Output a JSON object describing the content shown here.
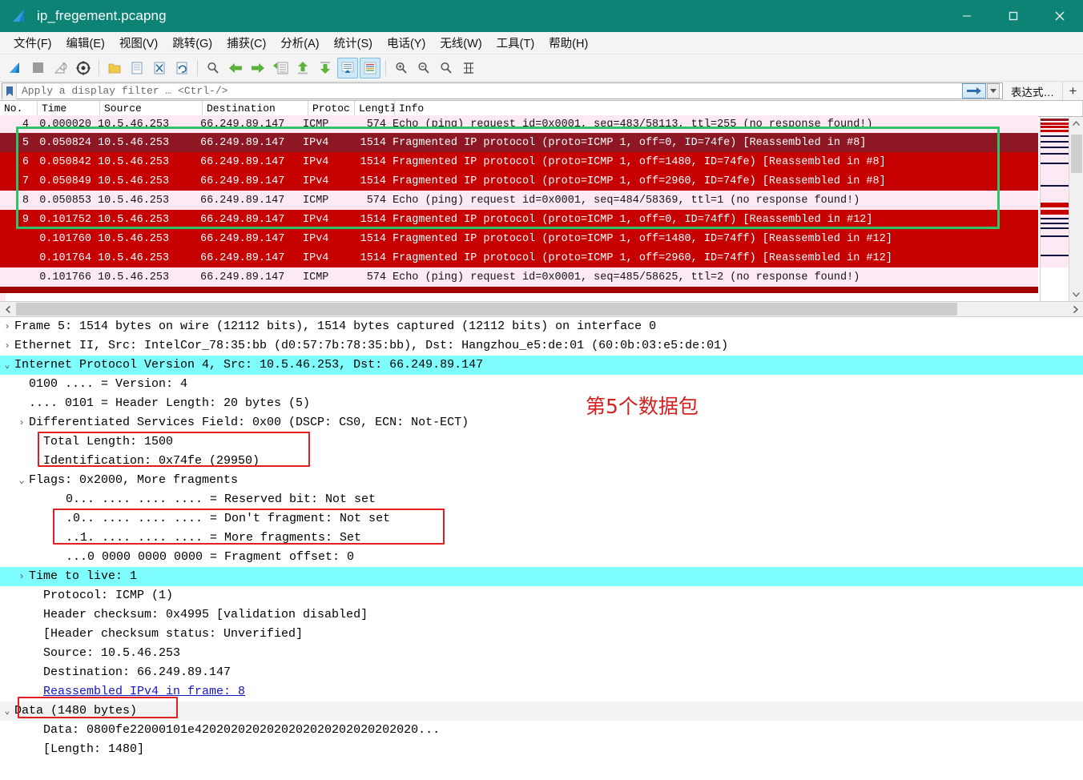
{
  "window": {
    "title": "ip_fregement.pcapng",
    "app_icon": "wireshark-fin-icon",
    "minimize_label": "—",
    "maximize_label": "☐",
    "close_label": "✕",
    "titlebar_color": "#0c8374"
  },
  "menu": {
    "items": [
      {
        "label": "文件(F)",
        "mnemonic": "F"
      },
      {
        "label": "编辑(E)",
        "mnemonic": "E"
      },
      {
        "label": "视图(V)",
        "mnemonic": "V"
      },
      {
        "label": "跳转(G)",
        "mnemonic": "G"
      },
      {
        "label": "捕获(C)",
        "mnemonic": "C"
      },
      {
        "label": "分析(A)",
        "mnemonic": "A"
      },
      {
        "label": "统计(S)",
        "mnemonic": "S"
      },
      {
        "label": "电话(Y)",
        "mnemonic": "Y"
      },
      {
        "label": "无线(W)",
        "mnemonic": "W"
      },
      {
        "label": "工具(T)",
        "mnemonic": "T"
      },
      {
        "label": "帮助(H)",
        "mnemonic": "H"
      }
    ]
  },
  "toolbar": {
    "buttons": [
      "start-capture-icon",
      "stop-capture-icon",
      "restart-capture-icon",
      "capture-options-icon",
      "open-file-icon",
      "save-file-icon",
      "close-file-icon",
      "reload-file-icon",
      "find-packet-icon",
      "go-back-icon",
      "go-forward-icon",
      "go-to-packet-icon",
      "go-first-packet-icon",
      "go-last-packet-icon",
      "auto-scroll-icon",
      "colorize-icon",
      "zoom-in-icon",
      "zoom-out-icon",
      "zoom-reset-icon",
      "resize-columns-icon"
    ]
  },
  "filter": {
    "placeholder": "Apply a display filter … <Ctrl-/>",
    "value": "",
    "bookmark_icon": "bookmark-icon",
    "apply_icon": "arrow-right-icon",
    "dropdown_icon": "chevron-down-icon",
    "expression_label": "表达式…",
    "plus_label": "+"
  },
  "packet_list": {
    "columns": [
      {
        "key": "no",
        "label": "No."
      },
      {
        "key": "time",
        "label": "Time"
      },
      {
        "key": "src",
        "label": "Source"
      },
      {
        "key": "dst",
        "label": "Destination"
      },
      {
        "key": "proto",
        "label": "Protoc"
      },
      {
        "key": "len",
        "label": "Lengtł"
      },
      {
        "key": "info",
        "label": "Info"
      }
    ],
    "rows": [
      {
        "no": "4",
        "time": "0.000020",
        "src": "10.5.46.253",
        "dst": "66.249.89.147",
        "proto": "ICMP",
        "len": "574",
        "info": "Echo (ping) request  id=0x0001, seq=483/58113, ttl=255 (no response found!)",
        "style": "icmp",
        "clipped_top": true
      },
      {
        "no": "5",
        "time": "0.050824",
        "src": "10.5.46.253",
        "dst": "66.249.89.147",
        "proto": "IPv4",
        "len": "1514",
        "info": "Fragmented IP protocol (proto=ICMP 1, off=0, ID=74fe) [Reassembled in #8]",
        "style": "selected"
      },
      {
        "no": "6",
        "time": "0.050842",
        "src": "10.5.46.253",
        "dst": "66.249.89.147",
        "proto": "IPv4",
        "len": "1514",
        "info": "Fragmented IP protocol (proto=ICMP 1, off=1480, ID=74fe) [Reassembled in #8]",
        "style": "ipv4"
      },
      {
        "no": "7",
        "time": "0.050849",
        "src": "10.5.46.253",
        "dst": "66.249.89.147",
        "proto": "IPv4",
        "len": "1514",
        "info": "Fragmented IP protocol (proto=ICMP 1, off=2960, ID=74fe) [Reassembled in #8]",
        "style": "ipv4"
      },
      {
        "no": "8",
        "time": "0.050853",
        "src": "10.5.46.253",
        "dst": "66.249.89.147",
        "proto": "ICMP",
        "len": "574",
        "info": "Echo (ping) request  id=0x0001, seq=484/58369, ttl=1 (no response found!)",
        "style": "icmp"
      },
      {
        "no": "9",
        "time": "0.101752",
        "src": "10.5.46.253",
        "dst": "66.249.89.147",
        "proto": "IPv4",
        "len": "1514",
        "info": "Fragmented IP protocol (proto=ICMP 1, off=0, ID=74ff) [Reassembled in #12]",
        "style": "ipv4"
      },
      {
        "no": "",
        "time": "0.101760",
        "src": "10.5.46.253",
        "dst": "66.249.89.147",
        "proto": "IPv4",
        "len": "1514",
        "info": "Fragmented IP protocol (proto=ICMP 1, off=1480, ID=74ff) [Reassembled in #12]",
        "style": "ipv4"
      },
      {
        "no": "",
        "time": "0.101764",
        "src": "10.5.46.253",
        "dst": "66.249.89.147",
        "proto": "IPv4",
        "len": "1514",
        "info": "Fragmented IP protocol (proto=ICMP 1, off=2960, ID=74ff) [Reassembled in #12]",
        "style": "ipv4"
      },
      {
        "no": "",
        "time": "0.101766",
        "src": "10.5.46.253",
        "dst": "66.249.89.147",
        "proto": "ICMP",
        "len": "574",
        "info": "Echo (ping) request  id=0x0001, seq=485/58625, ttl=2 (no response found!)",
        "style": "icmp"
      }
    ],
    "colors": {
      "icmp_row_bg": "#fce9f3",
      "ipv4_row_bg": "#c60000",
      "selected_row_bg": "#8e1724",
      "selected_row_fg": "#ffffff"
    },
    "green_annotation": {
      "name": "fragment-group-highlight",
      "covers_rows": "5-8"
    },
    "scrollbar": {
      "up_arrow": "chevron-up-icon",
      "down_arrow": "chevron-down-icon"
    },
    "hscroll": {
      "left_arrow": "chevron-left-icon",
      "right_arrow": "chevron-right-icon"
    }
  },
  "detail_pane": {
    "rows": [
      {
        "twisty": "collapsed",
        "indent": 0,
        "text": "Frame 5: 1514 bytes on wire (12112 bits), 1514 bytes captured (12112 bits) on interface 0",
        "style": "normal"
      },
      {
        "twisty": "collapsed",
        "indent": 0,
        "text": "Ethernet II, Src: IntelCor_78:35:bb (d0:57:7b:78:35:bb), Dst: Hangzhou_e5:de:01 (60:0b:03:e5:de:01)",
        "style": "normal"
      },
      {
        "twisty": "expanded",
        "indent": 0,
        "text": "Internet Protocol Version 4, Src: 10.5.46.253, Dst: 66.249.89.147",
        "style": "highlight"
      },
      {
        "twisty": "none",
        "indent": 2,
        "text": "0100 .... = Version: 4",
        "style": "normal"
      },
      {
        "twisty": "none",
        "indent": 2,
        "text": ".... 0101 = Header Length: 20 bytes (5)",
        "style": "normal"
      },
      {
        "twisty": "collapsed",
        "indent": 1,
        "text": "Differentiated Services Field: 0x00 (DSCP: CS0, ECN: Not-ECT)",
        "style": "normal"
      },
      {
        "twisty": "none",
        "indent": 2,
        "text": "Total Length: 1500",
        "style": "normal"
      },
      {
        "twisty": "none",
        "indent": 2,
        "text": "Identification: 0x74fe (29950)",
        "style": "normal"
      },
      {
        "twisty": "expanded",
        "indent": 1,
        "text": "Flags: 0x2000, More fragments",
        "style": "normal"
      },
      {
        "twisty": "none",
        "indent": 3,
        "text": "0... .... .... .... = Reserved bit: Not set",
        "style": "normal"
      },
      {
        "twisty": "none",
        "indent": 3,
        "text": ".0.. .... .... .... = Don't fragment: Not set",
        "style": "normal"
      },
      {
        "twisty": "none",
        "indent": 3,
        "text": "..1. .... .... .... = More fragments: Set",
        "style": "normal"
      },
      {
        "twisty": "none",
        "indent": 3,
        "text": "...0 0000 0000 0000 = Fragment offset: 0",
        "style": "normal"
      },
      {
        "twisty": "collapsed",
        "indent": 1,
        "text": "Time to live: 1",
        "style": "highlight"
      },
      {
        "twisty": "none",
        "indent": 2,
        "text": "Protocol: ICMP (1)",
        "style": "normal"
      },
      {
        "twisty": "none",
        "indent": 2,
        "text": "Header checksum: 0x4995 [validation disabled]",
        "style": "normal"
      },
      {
        "twisty": "none",
        "indent": 2,
        "text": "[Header checksum status: Unverified]",
        "style": "normal"
      },
      {
        "twisty": "none",
        "indent": 2,
        "text": "Source: 10.5.46.253",
        "style": "normal"
      },
      {
        "twisty": "none",
        "indent": 2,
        "text": "Destination: 66.249.89.147",
        "style": "normal"
      },
      {
        "twisty": "none",
        "indent": 2,
        "text": "Reassembled IPv4 in frame: 8",
        "style": "link"
      },
      {
        "twisty": "expanded",
        "indent": 0,
        "text": "Data (1480 bytes)",
        "style": "gray"
      },
      {
        "twisty": "none",
        "indent": 2,
        "text": "Data: 0800fe22000101e4202020202020202020202020202020...",
        "style": "normal"
      },
      {
        "twisty": "none",
        "indent": 2,
        "text": "[Length: 1480]",
        "style": "normal"
      }
    ]
  },
  "annotations": {
    "chinese_note": "第5个数据包",
    "note_color": "#d42020",
    "red_box_color": "#e02020",
    "green_box_color": "#2fc46a",
    "red_boxes": [
      {
        "name": "total-length-identification-highlight"
      },
      {
        "name": "fragment-flags-highlight"
      },
      {
        "name": "data-length-highlight"
      }
    ]
  }
}
